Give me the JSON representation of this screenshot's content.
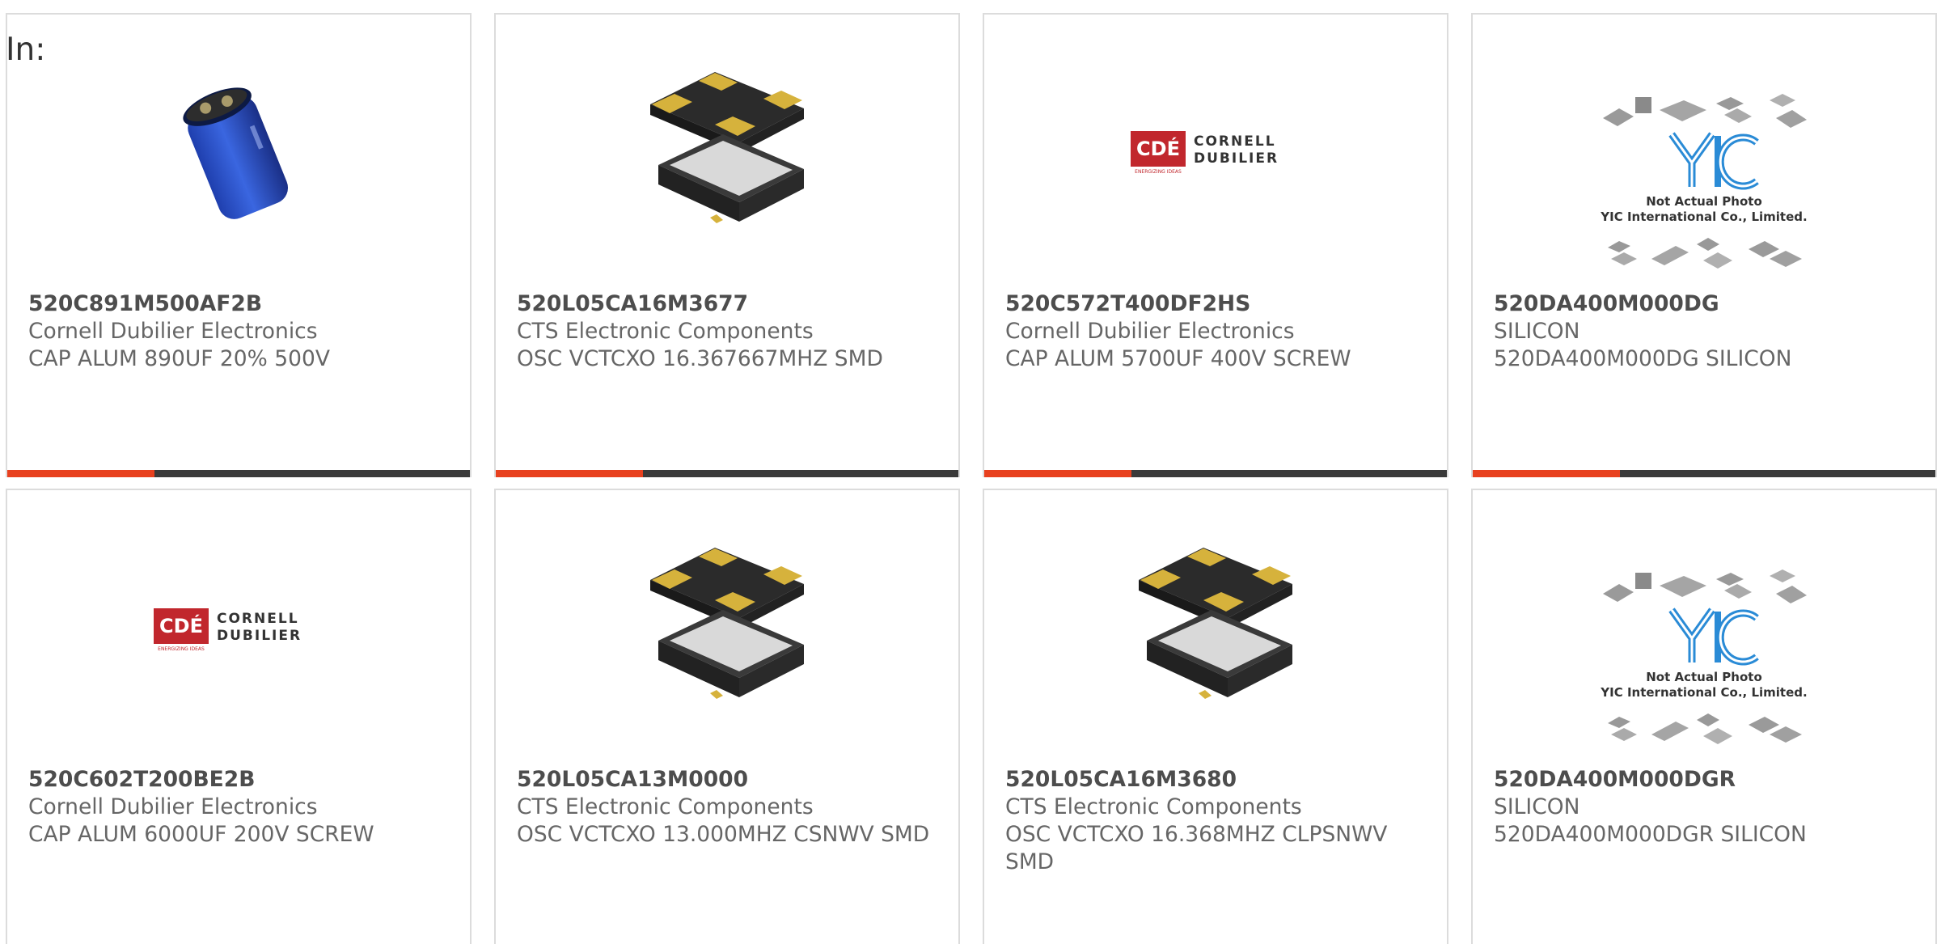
{
  "header": {
    "label": "In:"
  },
  "colors": {
    "accent": "#e8411f",
    "bar": "#3a3a3a",
    "border": "#dcdcdc",
    "text": "#666666"
  },
  "products": [
    {
      "part": "520C891M500AF2B",
      "manufacturer": "Cornell Dubilier Electronics",
      "description": "CAP ALUM 890UF 20% 500V",
      "image": "capacitor-photo"
    },
    {
      "part": "520L05CA16M3677",
      "manufacturer": "CTS Electronic Components",
      "description": "OSC VCTCXO 16.367667MHZ SMD",
      "image": "oscillator-photo"
    },
    {
      "part": "520C572T400DF2HS",
      "manufacturer": "Cornell Dubilier Electronics",
      "description": "CAP ALUM 5700UF 400V SCREW",
      "image": "cde-logo"
    },
    {
      "part": "520DA400M000DG",
      "manufacturer": "SILICON",
      "description": "520DA400M000DG SILICON",
      "image": "yic-placeholder",
      "image_text": {
        "brand": "YIC",
        "line1": "Not Actual Photo",
        "line2": "YIC International Co., Limited."
      }
    },
    {
      "part": "520C602T200BE2B",
      "manufacturer": "Cornell Dubilier Electronics",
      "description": "CAP ALUM 6000UF 200V SCREW",
      "image": "cde-logo"
    },
    {
      "part": "520L05CA13M0000",
      "manufacturer": "CTS Electronic Components",
      "description": "OSC VCTCXO 13.000MHZ CSNWV SMD",
      "image": "oscillator-photo"
    },
    {
      "part": "520L05CA16M3680",
      "manufacturer": "CTS Electronic Components",
      "description": "OSC VCTCXO 16.368MHZ CLPSNWV SMD",
      "image": "oscillator-photo"
    },
    {
      "part": "520DA400M000DGR",
      "manufacturer": "SILICON",
      "description": "520DA400M000DGR SILICON",
      "image": "yic-placeholder",
      "image_text": {
        "brand": "YIC",
        "line1": "Not Actual Photo",
        "line2": "YIC International Co., Limited."
      }
    }
  ],
  "logos": {
    "cde": {
      "mark": "CDÉ",
      "line1": "CORNELL",
      "line2": "DUBILIER",
      "tagline": "ENERGIZING IDEAS"
    }
  }
}
